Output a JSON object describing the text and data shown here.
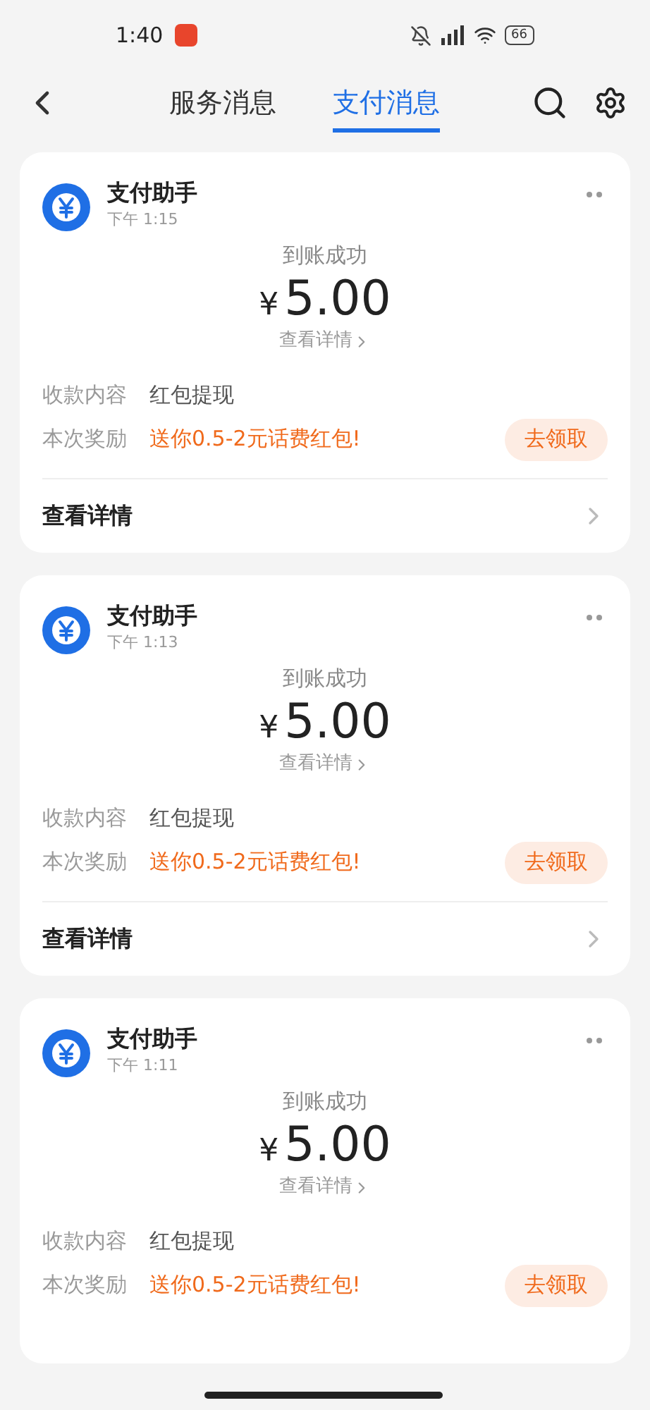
{
  "status_bar": {
    "time": "1:40",
    "battery": "66"
  },
  "header": {
    "tabs": [
      {
        "label": "服务消息",
        "selected": false
      },
      {
        "label": "支付消息",
        "selected": true
      }
    ]
  },
  "messages": [
    {
      "sender": "支付助手",
      "time": "下午 1:15",
      "status": "到账成功",
      "currency": "¥",
      "amount": "5.00",
      "detail_link": "查看详情",
      "rows": [
        {
          "label": "收款内容",
          "value": "红包提现",
          "kind": "plain"
        },
        {
          "label": "本次奖励",
          "value": "送你0.5-2元话费红包!",
          "kind": "promo",
          "action": "去领取"
        }
      ],
      "footer_link": "查看详情"
    },
    {
      "sender": "支付助手",
      "time": "下午 1:13",
      "status": "到账成功",
      "currency": "¥",
      "amount": "5.00",
      "detail_link": "查看详情",
      "rows": [
        {
          "label": "收款内容",
          "value": "红包提现",
          "kind": "plain"
        },
        {
          "label": "本次奖励",
          "value": "送你0.5-2元话费红包!",
          "kind": "promo",
          "action": "去领取"
        }
      ],
      "footer_link": "查看详情"
    },
    {
      "sender": "支付助手",
      "time": "下午 1:11",
      "status": "到账成功",
      "currency": "¥",
      "amount": "5.00",
      "detail_link": "查看详情",
      "rows": [
        {
          "label": "收款内容",
          "value": "红包提现",
          "kind": "plain"
        },
        {
          "label": "本次奖励",
          "value": "送你0.5-2元话费红包!",
          "kind": "promo",
          "action": "去领取"
        }
      ]
    }
  ]
}
